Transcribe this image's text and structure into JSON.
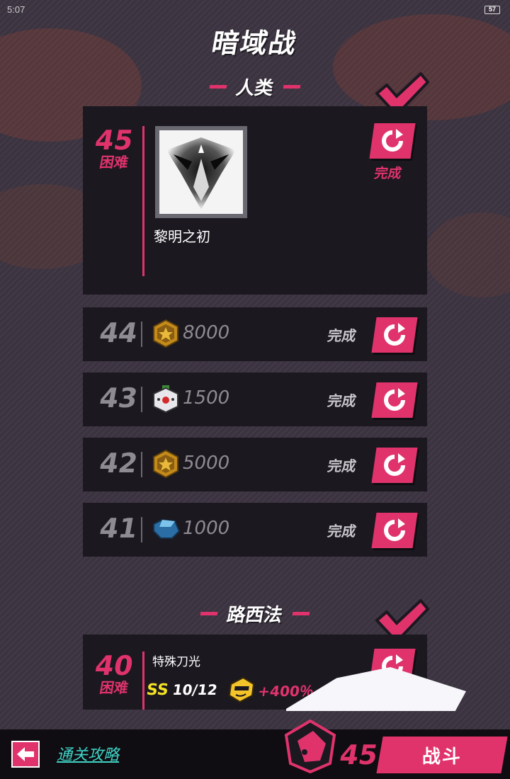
{
  "status": {
    "time": "5:07",
    "battery": "57"
  },
  "title": "暗域战",
  "section1": {
    "name": "人类"
  },
  "featured": {
    "level": "45",
    "difficulty": "困难",
    "stage_name": "黎明之初",
    "status": "完成"
  },
  "rows": [
    {
      "level": "44",
      "reward_icon": "gold-coin-icon",
      "value": "8000",
      "status": "完成"
    },
    {
      "level": "43",
      "reward_icon": "robot-head-icon",
      "value": "1500",
      "status": "完成"
    },
    {
      "level": "42",
      "reward_icon": "gold-coin-icon",
      "value": "5000",
      "status": "完成"
    },
    {
      "level": "41",
      "reward_icon": "blue-crystal-icon",
      "value": "1000",
      "status": "完成"
    }
  ],
  "section2": {
    "name": "路西法"
  },
  "bottom_card": {
    "level": "40",
    "difficulty": "困难",
    "special_name": "特殊刀光",
    "ss_tag": "SS",
    "ss_value": "10/12",
    "bonus": "+400％"
  },
  "bottom_bar": {
    "guide": "通关攻略",
    "level": "45",
    "fight": "战斗"
  },
  "colors": {
    "accent": "#e0336c",
    "card": "#1c1820",
    "link": "#3fd3c6",
    "ss": "#f3e324"
  }
}
